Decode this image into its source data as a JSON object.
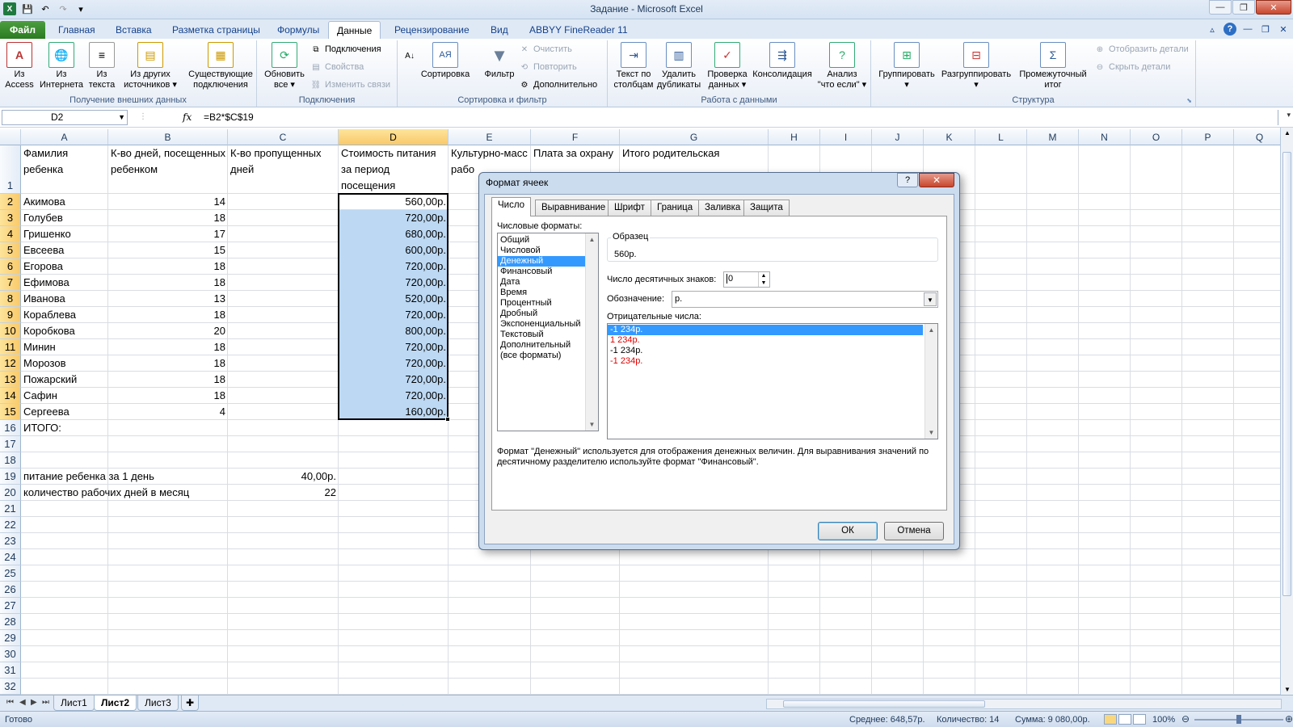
{
  "window": {
    "title": "Задание  -  Microsoft Excel"
  },
  "qat": {
    "logo": "X",
    "save_icon": "save-icon",
    "undo": "↶",
    "redo": "↷"
  },
  "tabs": [
    "Файл",
    "Главная",
    "Вставка",
    "Разметка страницы",
    "Формулы",
    "Данные",
    "Рецензирование",
    "Вид",
    "ABBYY FineReader 11"
  ],
  "ribbon": {
    "groups": {
      "external": {
        "label": "Получение внешних данных",
        "btn_access": "Из\nAccess",
        "btn_web": "Из\nИнтернета",
        "btn_text": "Из\nтекста",
        "btn_other": "Из других\nисточников ▾",
        "btn_existing": "Существующие\nподключения"
      },
      "connections": {
        "label": "Подключения",
        "btn_refresh": "Обновить\nвсе ▾",
        "connections": "Подключения",
        "properties": "Свойства",
        "edit_links": "Изменить связи"
      },
      "sortfilter": {
        "label": "Сортировка и фильтр",
        "sort": "Сортировка",
        "filter": "Фильтр",
        "clear": "Очистить",
        "reapply": "Повторить",
        "advanced": "Дополнительно"
      },
      "datatools": {
        "label": "Работа с данными",
        "text_to_cols": "Текст по\nстолбцам",
        "remove_dup": "Удалить\nдубликаты",
        "validation": "Проверка\nданных ▾",
        "consolidate": "Консолидация",
        "whatif": "Анализ\n\"что если\" ▾"
      },
      "outline": {
        "label": "Структура",
        "group": "Группировать\n▾",
        "ungroup": "Разгруппировать\n▾",
        "subtotal": "Промежуточный\nитог",
        "show_detail": "Отобразить детали",
        "hide_detail": "Скрыть детали"
      }
    }
  },
  "formula_bar": {
    "name_box": "D2",
    "fx": "fx",
    "formula": "=B2*$C$19"
  },
  "columns": [
    "A",
    "B",
    "C",
    "D",
    "E",
    "F",
    "G",
    "H",
    "I",
    "J",
    "K",
    "L",
    "M",
    "N",
    "O",
    "P",
    "Q"
  ],
  "header_row": {
    "A": "Фамилия ребенка",
    "B": "К-во дней, посещенных ребенком",
    "C": "К-во пропущенных дней",
    "D": "Стоимость питания за период посещения",
    "E": "Культурно-масс рабо",
    "F": "Плата за охрану",
    "G": "Итого родительская"
  },
  "rows": [
    {
      "num": "2",
      "A": "Акимова",
      "B": "14",
      "D": "560,00р."
    },
    {
      "num": "3",
      "A": "Голубев",
      "B": "18",
      "D": "720,00р."
    },
    {
      "num": "4",
      "A": "Гришенко",
      "B": "17",
      "D": "680,00р."
    },
    {
      "num": "5",
      "A": "Евсеева",
      "B": "15",
      "D": "600,00р."
    },
    {
      "num": "6",
      "A": "Егорова",
      "B": "18",
      "D": "720,00р."
    },
    {
      "num": "7",
      "A": "Ефимова",
      "B": "18",
      "D": "720,00р."
    },
    {
      "num": "8",
      "A": "Иванова",
      "B": "13",
      "D": "520,00р."
    },
    {
      "num": "9",
      "A": "Кораблева",
      "B": "18",
      "D": "720,00р."
    },
    {
      "num": "10",
      "A": "Коробкова",
      "B": "20",
      "D": "800,00р."
    },
    {
      "num": "11",
      "A": "Минин",
      "B": "18",
      "D": "720,00р."
    },
    {
      "num": "12",
      "A": "Морозов",
      "B": "18",
      "D": "720,00р."
    },
    {
      "num": "13",
      "A": "Пожарский",
      "B": "18",
      "D": "720,00р."
    },
    {
      "num": "14",
      "A": "Сафин",
      "B": "18",
      "D": "720,00р."
    },
    {
      "num": "15",
      "A": "Сергеева",
      "B": "4",
      "D": "160,00р."
    }
  ],
  "row16": {
    "A": "ИТОГО:"
  },
  "row19": {
    "A": "питание ребенка за 1 день",
    "C": "40,00р."
  },
  "row20": {
    "A": "количество рабочих дней в месяц",
    "C": "22"
  },
  "row_numbers": [
    "1",
    "2",
    "3",
    "4",
    "5",
    "6",
    "7",
    "8",
    "9",
    "10",
    "11",
    "12",
    "13",
    "14",
    "15",
    "16",
    "17",
    "18",
    "19",
    "20",
    "21",
    "22",
    "23",
    "24",
    "25",
    "26",
    "27",
    "28",
    "29",
    "30",
    "31",
    "32"
  ],
  "sheets": [
    "Лист1",
    "Лист2",
    "Лист3"
  ],
  "active_sheet": "Лист2",
  "status": {
    "ready": "Готово",
    "average": "Среднее: 648,57р.",
    "count": "Количество: 14",
    "sum": "Сумма: 9 080,00р.",
    "zoom": "100%"
  },
  "dialog": {
    "title": "Формат ячеек",
    "help": "?",
    "close": "✕",
    "tabs": [
      "Число",
      "Выравнивание",
      "Шрифт",
      "Граница",
      "Заливка",
      "Защита"
    ],
    "formats_label": "Числовые форматы:",
    "formats": [
      "Общий",
      "Числовой",
      "Денежный",
      "Финансовый",
      "Дата",
      "Время",
      "Процентный",
      "Дробный",
      "Экспоненциальный",
      "Текстовый",
      "Дополнительный",
      "(все форматы)"
    ],
    "selected_format": "Денежный",
    "sample_label": "Образец",
    "sample_value": "560р.",
    "decimals_label": "Число десятичных знаков:",
    "decimals_value": "0",
    "symbol_label": "Обозначение:",
    "symbol_value": "р.",
    "negative_label": "Отрицательные числа:",
    "negatives": [
      {
        "text": "-1 234р.",
        "red": false,
        "selected": true
      },
      {
        "text": "1 234р.",
        "red": true,
        "selected": false
      },
      {
        "text": "-1 234р.",
        "red": false,
        "selected": false
      },
      {
        "text": "-1 234р.",
        "red": true,
        "selected": false
      }
    ],
    "description": "Формат \"Денежный\" используется для отображения денежных величин. Для выравнивания значений по десятичному разделителю используйте формат \"Финансовый\".",
    "ok": "ОК",
    "cancel": "Отмена"
  }
}
